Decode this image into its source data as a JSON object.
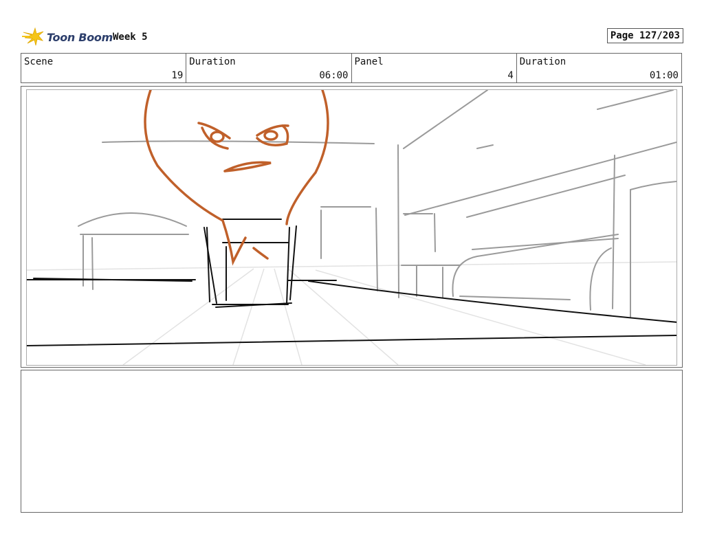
{
  "header": {
    "brand": "Toon Boom",
    "project": "Week 5",
    "page_label": "Page 127/203"
  },
  "info": {
    "scene_label": "Scene",
    "scene_value": "19",
    "duration_label": "Duration",
    "duration_value": "06:00",
    "panel_label": "Panel",
    "panel_value": "4",
    "panel_duration_label": "Duration",
    "panel_duration_value": "01:00"
  },
  "colors": {
    "sketch_character": "#c0602a",
    "sketch_lines": "#111111",
    "sketch_background": "#9a9a9a",
    "logo_star": "#f5c518"
  },
  "icons": {
    "logo": "toon-boom-star-icon"
  }
}
